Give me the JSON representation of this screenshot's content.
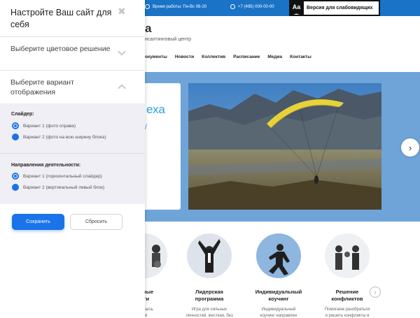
{
  "colors": {
    "topbar": "#1a73c6",
    "accent": "#1a73e8",
    "hero_bg": "#6fa4d9",
    "panel_options_bg": "#efeff5",
    "hero_text": "#2aa3d8"
  },
  "topbar": {
    "hours": "Время работы: Пн-Вс 08-20",
    "phone": "+7 (495) 000-00-00",
    "vision_icon_text": "Aa",
    "vision_label": "Версия для слабовидящих"
  },
  "header": {
    "logo_fragment": "а",
    "subtitle_fragment": "нсалтинговый центр"
  },
  "nav": {
    "items": [
      "окументы",
      "Новости",
      "Коллектив",
      "Расписание",
      "Медиа",
      "Контакты"
    ]
  },
  "hero": {
    "title_fragment": "еха",
    "subtitle_fragment": "/"
  },
  "services": [
    {
      "title_l1": "ивные",
      "title_l2": "нги",
      "desc_l1": "рсонала,",
      "desc_l2": "ия"
    },
    {
      "title_l1": "Лидерская",
      "title_l2": "программа",
      "desc_l1": "Игра для сильных",
      "desc_l2": "личностей, жесткая, без"
    },
    {
      "title_l1": "Индивидуальный",
      "title_l2": "коучинг",
      "desc_l1": "Индивидуальный",
      "desc_l2": "коучинг направлен"
    },
    {
      "title_l1": "Решение",
      "title_l2": "конфликтов",
      "desc_l1": "Помогаем разобраться",
      "desc_l2": "и решить конфликты в"
    }
  ],
  "panel": {
    "title": "Настройте Ваш сайт для себя",
    "close_icon": "✖",
    "color_scheme_label": "Выберите цветовое решение",
    "variant_label": "Выберите вариант отображения",
    "slider_group_title": "Слайдер:",
    "slider_options": [
      "Вариант 1 (фото справа)",
      "Вариант 2 (фото на всю ширину блока)"
    ],
    "slider_selected": 0,
    "directions_group_title": "Направления деятельности:",
    "directions_options": [
      "Вариант 1 (горизонтальный слайдер)",
      "Вариант 2 (вертикальный левый блок)"
    ],
    "directions_selected": 0,
    "save_label": "Сохранить",
    "reset_label": "Сбросить"
  }
}
